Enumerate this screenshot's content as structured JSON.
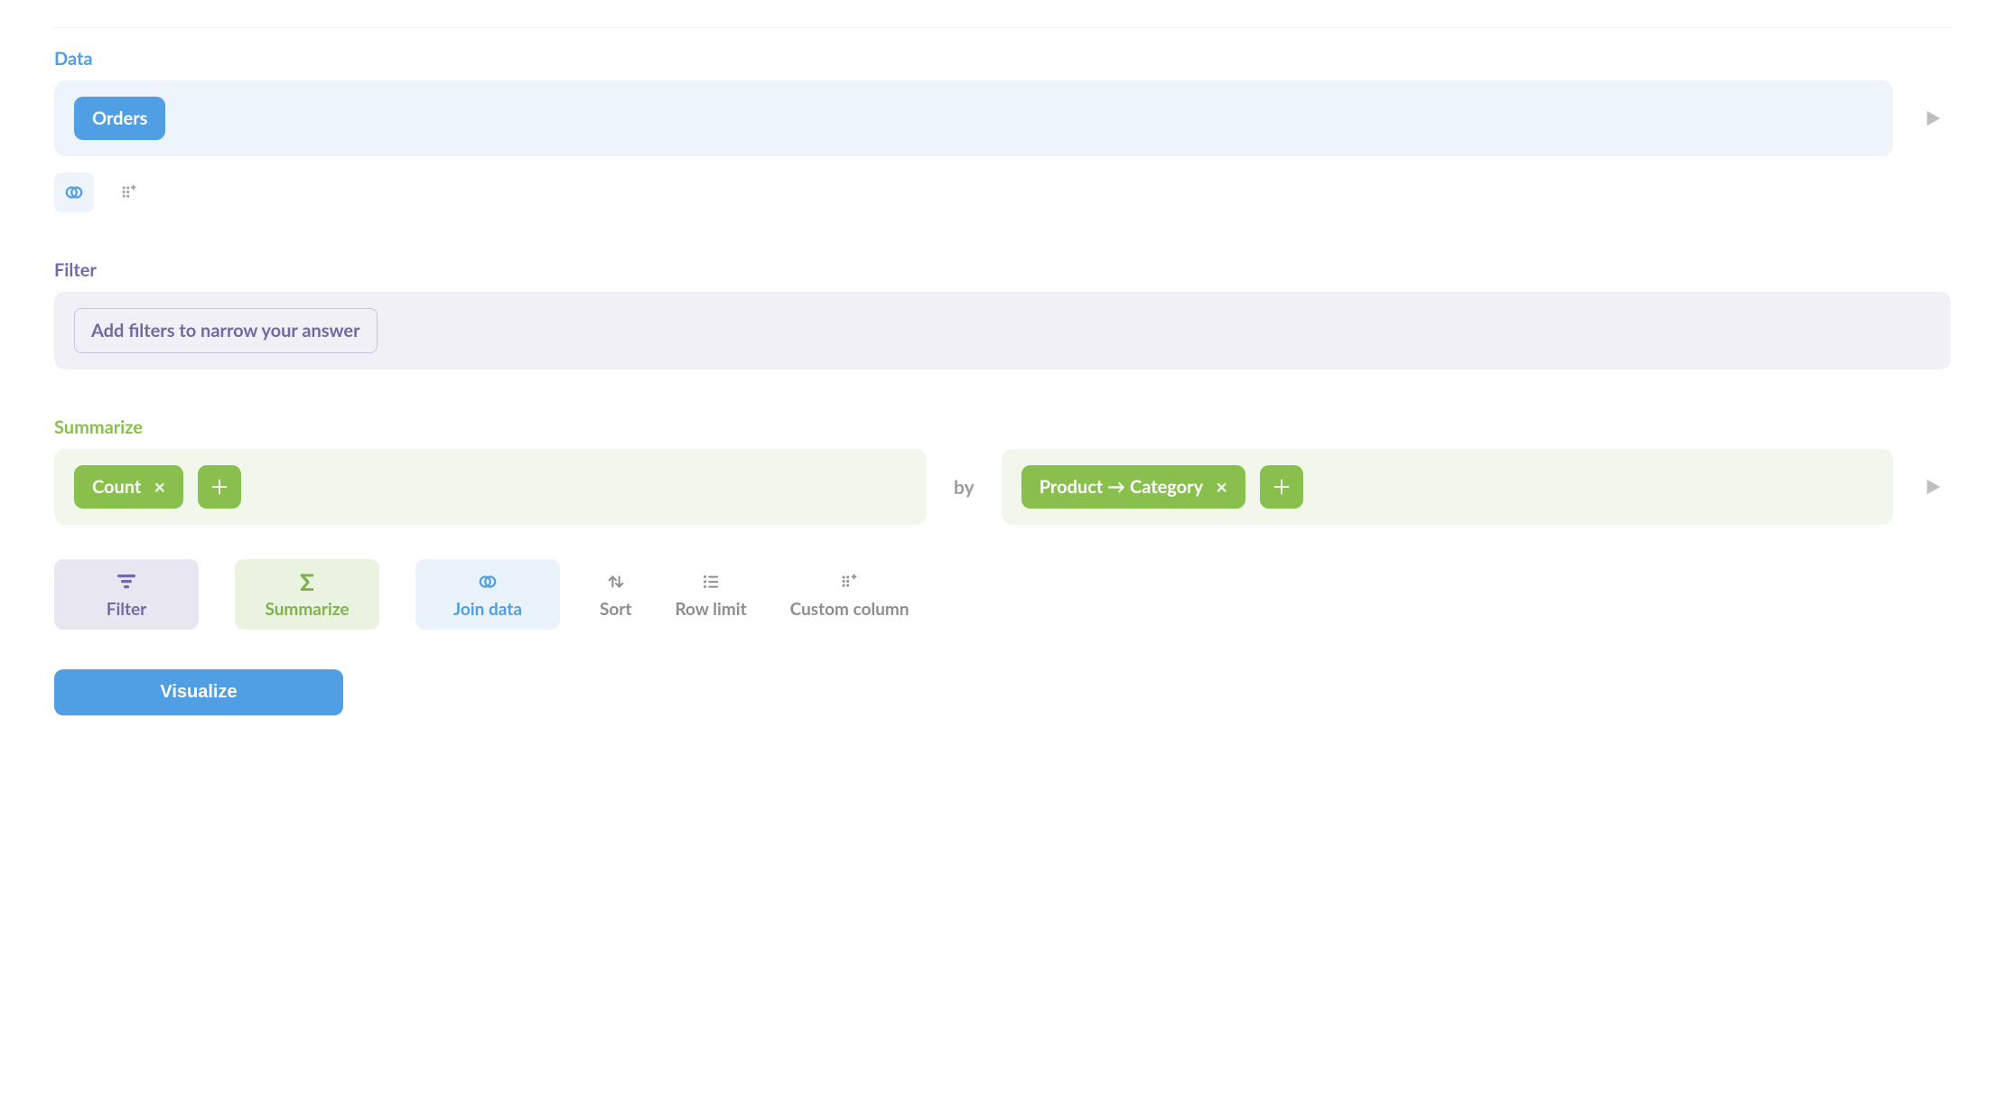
{
  "data": {
    "label": "Data",
    "data_source": "Orders"
  },
  "filter": {
    "label": "Filter",
    "placeholder": "Add filters to narrow your answer"
  },
  "summarize": {
    "label": "Summarize",
    "aggregation": "Count",
    "by_label": "by",
    "groupby": "Product → Category"
  },
  "actions": {
    "filter": "Filter",
    "summarize": "Summarize",
    "join": "Join data",
    "sort": "Sort",
    "row_limit": "Row limit",
    "custom_column": "Custom column"
  },
  "visualize_label": "Visualize"
}
